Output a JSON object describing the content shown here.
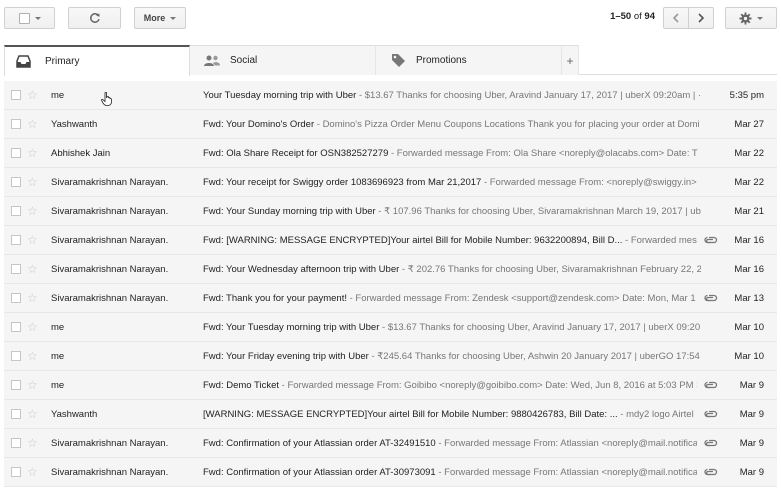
{
  "toolbar": {
    "more_label": "More",
    "pager_range": "1–50",
    "pager_of": "of",
    "pager_total": "94"
  },
  "tabs": [
    {
      "label": "Primary",
      "icon": "inbox-icon"
    },
    {
      "label": "Social",
      "icon": "people-icon"
    },
    {
      "label": "Promotions",
      "icon": "tag-icon"
    }
  ],
  "add_tab_label": "+",
  "emails": [
    {
      "sender": "me",
      "subject": "Your Tuesday morning trip with Uber",
      "snippet": " - $13.67 Thanks for choosing Uber, Aravind January 17, 2017 | uberX 09:20am | ·",
      "date": "5:35 pm",
      "attachment": false
    },
    {
      "sender": "Yashwanth",
      "subject": "Fwd: Your Domino's Order",
      "snippet": " - Domino's Pizza Order Menu Coupons Locations Thank you for placing your order at Domi",
      "date": "Mar 27",
      "attachment": false
    },
    {
      "sender": "Abhishek Jain",
      "subject": "Fwd: Ola Share Receipt for OSN382527279",
      "snippet": " - Forwarded message From: Ola Share <noreply@olacabs.com> Date: T",
      "date": "Mar 22",
      "attachment": false
    },
    {
      "sender": "Sivaramakrishnan Narayan.",
      "subject": "Fwd: Your receipt for Swiggy order 1083696923 from Mar 21,2017",
      "snippet": " - Forwarded message From: <noreply@swiggy.in>",
      "date": "Mar 22",
      "attachment": false
    },
    {
      "sender": "Sivaramakrishnan Narayan.",
      "subject": "Fwd: Your Sunday morning trip with Uber",
      "snippet": " - ₹ 107.96 Thanks for choosing Uber, Sivaramakrishnan March 19, 2017 | ub",
      "date": "Mar 21",
      "attachment": false
    },
    {
      "sender": "Sivaramakrishnan Narayan.",
      "subject": "Fwd: [WARNING: MESSAGE ENCRYPTED]Your airtel Bill for Mobile Number: 9632200894, Bill D...",
      "snippet": " - Forwarded mes",
      "date": "Mar 16",
      "attachment": true
    },
    {
      "sender": "Sivaramakrishnan Narayan.",
      "subject": "Fwd: Your Wednesday afternoon trip with Uber",
      "snippet": " - ₹ 202.76 Thanks for choosing Uber, Sivaramakrishnan February 22, 2",
      "date": "Mar 16",
      "attachment": false
    },
    {
      "sender": "Sivaramakrishnan Narayan.",
      "subject": "Fwd: Thank you for your payment!",
      "snippet": " - Forwarded message From: Zendesk <support@zendesk.com> Date: Mon, Mar 1",
      "date": "Mar 13",
      "attachment": true
    },
    {
      "sender": "me",
      "subject": "Fwd: Your Tuesday morning trip with Uber",
      "snippet": " - $13.67 Thanks for choosing Uber, Aravind January 17, 2017 | uberX 09:20",
      "date": "Mar 10",
      "attachment": false
    },
    {
      "sender": "me",
      "subject": "Fwd: Your Friday evening trip with Uber",
      "snippet": " - ₹245.64 Thanks for choosing Uber, Ashwin 20 January 2017 | uberGO 17:54",
      "date": "Mar 10",
      "attachment": false
    },
    {
      "sender": "me",
      "subject": "Fwd: Demo Ticket",
      "snippet": " - Forwarded message From: Goibibo <noreply@goibibo.com> Date: Wed, Jun 8, 2016 at 5:03 PM S",
      "date": "Mar 9",
      "attachment": true
    },
    {
      "sender": "Yashwanth",
      "subject": "[WARNING: MESSAGE ENCRYPTED]Your airtel Bill for Mobile Number: 9880426783, Bill Date: ...",
      "snippet": " - mdy2 logo Airtel r",
      "date": "Mar 9",
      "attachment": true
    },
    {
      "sender": "Sivaramakrishnan Narayan.",
      "subject": "Fwd: Confirmation of your Atlassian order AT-32491510",
      "snippet": " - Forwarded message From: Atlassian <noreply@mail.notifica",
      "date": "Mar 9",
      "attachment": true
    },
    {
      "sender": "Sivaramakrishnan Narayan.",
      "subject": "Fwd: Confirmation of your Atlassian order AT-30973091",
      "snippet": " - Forwarded message From: Atlassian <noreply@mail.notifica",
      "date": "Mar 9",
      "attachment": true
    }
  ]
}
